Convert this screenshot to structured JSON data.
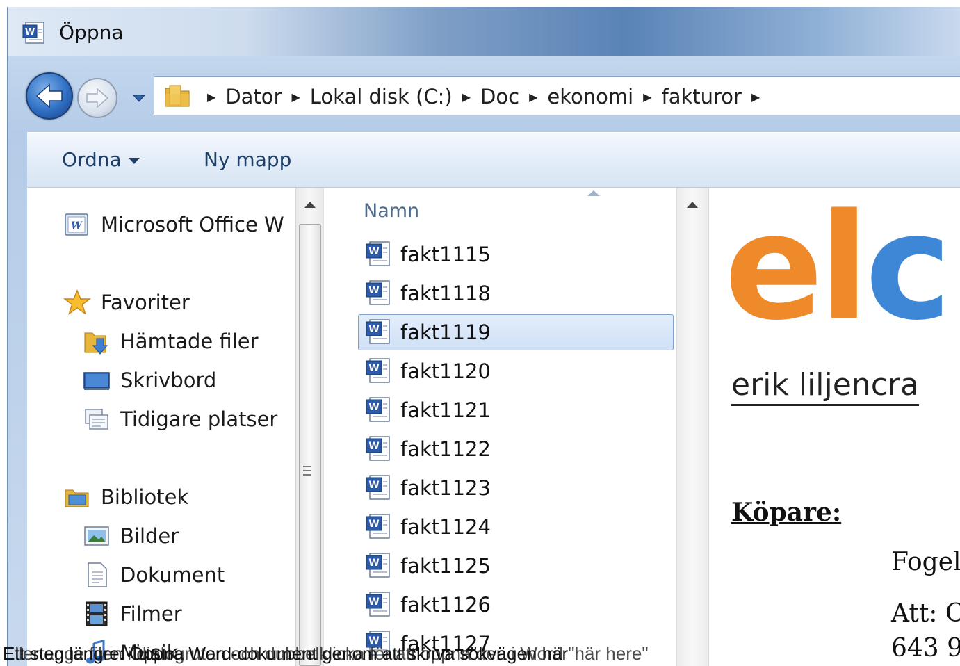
{
  "window": {
    "title": "Öppna"
  },
  "address": {
    "crumbs": [
      "Dator",
      "Lokal disk (C:)",
      "Doc",
      "ekonomi",
      "fakturor"
    ]
  },
  "toolbar": {
    "organize_label": "Ordna",
    "new_folder_label": "Ny mapp"
  },
  "nav": {
    "office_label": "Microsoft Office W",
    "favorites_label": "Favoriter",
    "downloads_label": "Hämtade filer",
    "desktop_label": "Skrivbord",
    "recent_label": "Tidigare platser",
    "libraries_label": "Bibliotek",
    "pictures_label": "Bilder",
    "documents_label": "Dokument",
    "videos_label": "Filmer",
    "music_label": "Musik"
  },
  "filelist": {
    "column_header": "Namn",
    "files": [
      "fakt1115",
      "fakt1118",
      "fakt1119",
      "fakt1120",
      "fakt1121",
      "fakt1122",
      "fakt1123",
      "fakt1124",
      "fakt1125",
      "fakt1126",
      "fakt1127"
    ],
    "selected": "fakt1119"
  },
  "preview": {
    "logo_e": "e",
    "logo_l": "l",
    "logo_c": "c",
    "company_name": "erik liljencra",
    "buyer_label": "Köpare:",
    "buyer_line1": "Fogel",
    "buyer_line2": "Att: C",
    "buyer_line3": "643 9"
  },
  "caption": {
    "line1": "Ett steg längre: Öppna Word-dokument genom att skriva sökvägen här",
    "line2": "Eller ange filen i dialogrutan och dubbelklicka för att öppna den i Word \"här here\""
  },
  "colors": {
    "accent": "#3e87d6",
    "logo_orange": "#ee8a2a",
    "selection_border": "#7da2ce"
  }
}
